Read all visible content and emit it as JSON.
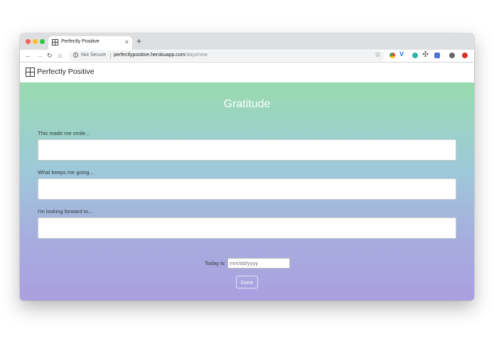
{
  "browser": {
    "tab": {
      "title": "Perfectly Positive",
      "close_glyph": "×"
    },
    "new_tab_glyph": "+",
    "nav": {
      "back_glyph": "←",
      "forward_glyph": "→",
      "reload_glyph": "↻",
      "home_glyph": "⌂"
    },
    "omnibox": {
      "security_label": "Not Secure",
      "url_host": "perfectlypositive.herokuapp.com",
      "url_path": "/days/new"
    },
    "bookmark_glyph": "☆",
    "extensions": [
      {
        "name": "color-wheel-icon"
      },
      {
        "name": "v-extension-icon",
        "glyph": "V"
      },
      {
        "name": "teal-circle-icon"
      },
      {
        "name": "crosshair-icon",
        "glyph": "✣"
      },
      {
        "name": "camera-icon"
      },
      {
        "name": "profile-avatar-icon"
      },
      {
        "name": "red-circle-icon"
      }
    ],
    "colors": {
      "traffic_red": "#fe5f57",
      "traffic_yellow": "#febc2e",
      "traffic_green": "#28c840"
    }
  },
  "site": {
    "brand": "Perfectly Positive"
  },
  "page": {
    "title": "Gratitude",
    "fields": [
      {
        "label": "This made me smile...",
        "value": ""
      },
      {
        "label": "What keeps me going...",
        "value": ""
      },
      {
        "label": "I'm looking forward to...",
        "value": ""
      }
    ],
    "date": {
      "label": "Today is:",
      "placeholder": "mm/dd/yyyy"
    },
    "submit_label": "Done",
    "gradient": {
      "top": "#99dbb0",
      "bottom": "#ab9fe0"
    }
  }
}
